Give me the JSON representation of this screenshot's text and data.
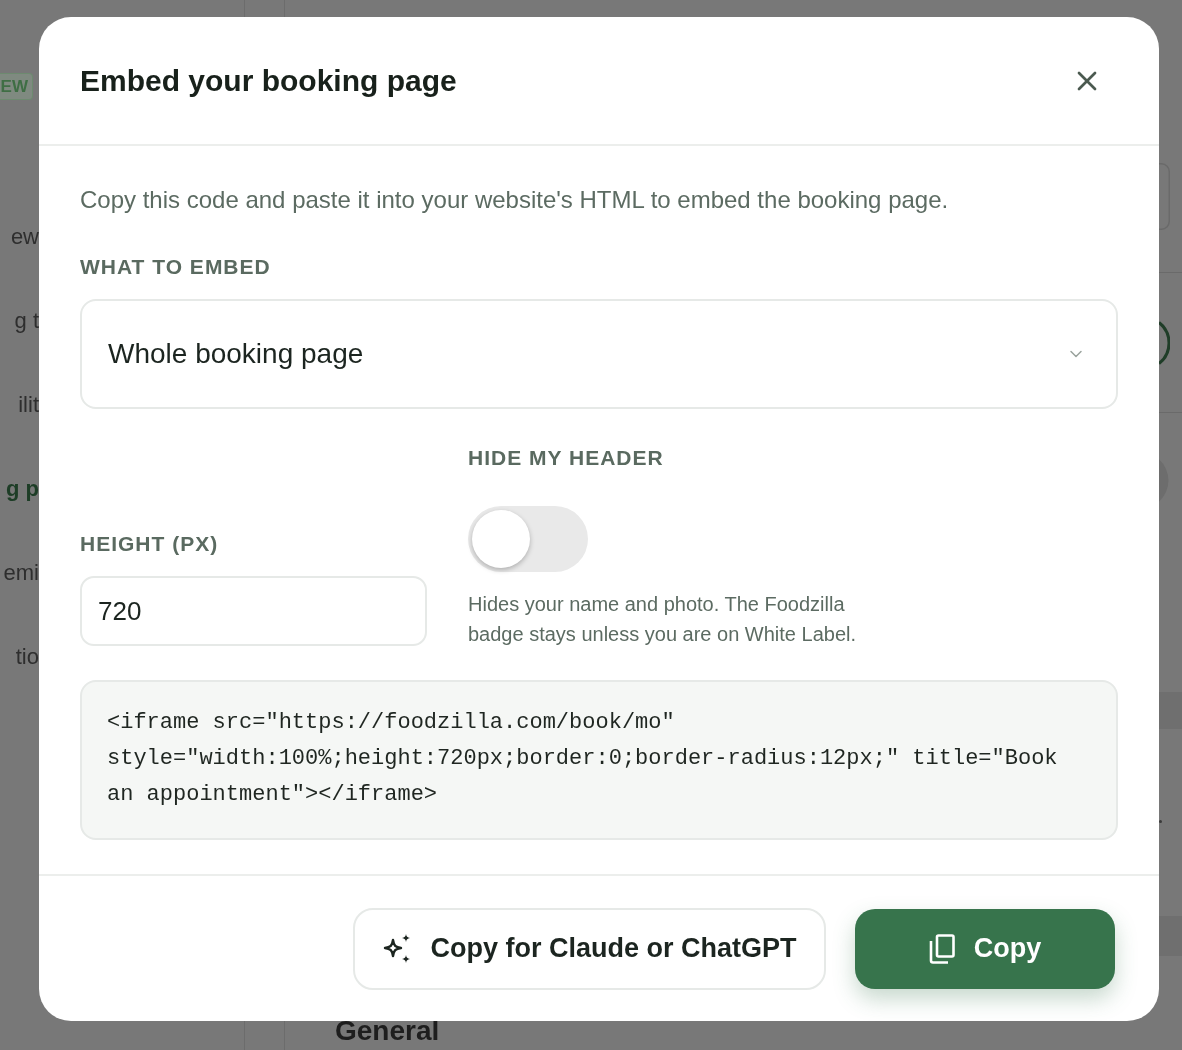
{
  "background": {
    "badge": "EW",
    "sidebar": {
      "items": [
        {
          "label": "ew",
          "selected": false
        },
        {
          "label": "g t",
          "selected": false
        },
        {
          "label": "ilit",
          "selected": false
        },
        {
          "label": "g p",
          "selected": true
        },
        {
          "label": "emi",
          "selected": false
        },
        {
          "label": "tio",
          "selected": false
        }
      ]
    },
    "heading": "General"
  },
  "dialog": {
    "title": "Embed your booking page",
    "description": "Copy this code and paste it into your website's HTML to embed the booking page.",
    "embed_select": {
      "label": "WHAT TO EMBED",
      "value": "Whole booking page"
    },
    "height_field": {
      "label": "HEIGHT (PX)",
      "value": "720"
    },
    "hide_header": {
      "label": "HIDE MY HEADER",
      "on": false,
      "hint": "Hides your name and photo. The Foodzilla badge stays unless you are on White Label."
    },
    "code": "<iframe src=\"https://foodzilla.com/book/mo\" style=\"width:100%;height:720px;border:0;border-radius:12px;\" title=\"Book an appointment\"></iframe>",
    "buttons": [
      {
        "kind": "secondary",
        "label": "Copy for Claude or ChatGPT"
      },
      {
        "kind": "primary",
        "label": "Copy"
      }
    ]
  }
}
